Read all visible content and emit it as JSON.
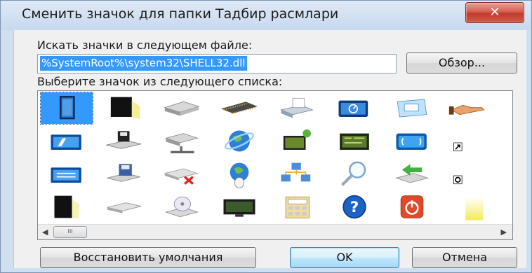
{
  "window": {
    "title": "Сменить значок для папки Тадбир расмлари",
    "close_glyph": "✕"
  },
  "dialog": {
    "file_label": "Искать значки в следующем файле:",
    "file_path": "%SystemRoot%\\system32\\SHELL32.dll",
    "browse_label": "Обзор...",
    "list_label": "Выберите значок из следующего списка:",
    "restore_label": "Восстановить умолчания",
    "ok_label": "OK",
    "cancel_label": "Отмена"
  },
  "icons": [
    [
      "blank-document-icon",
      "black-monitor-icon",
      "hard-drive-icon",
      "memory-chip-icon",
      "printer-icon",
      "display-settings-icon",
      "tablet-screen-icon",
      "hand-share-icon"
    ],
    [
      "card-reader-icon",
      "floppy-drive-icon",
      "network-drive-icon",
      "internet-globe-icon",
      "monitor-plant-icon",
      "circuit-board-icon",
      "screen-brackets-icon",
      "shortcut-arrow-overlay-icon"
    ],
    [
      "keyboard-panel-icon",
      "floppy-disk-icon",
      "disconnected-drive-icon",
      "globe-mouse-icon",
      "network-computers-icon",
      "magnifier-icon",
      "green-arrow-drive-icon",
      "disc-overlay-icon"
    ],
    [
      "dark-folder-icon",
      "flat-drive-icon",
      "cd-drive-icon",
      "lcd-monitor-icon",
      "calculator-panel-icon",
      "help-question-icon",
      "power-off-icon",
      "yellow-light-icon"
    ]
  ],
  "selected_icon": [
    0,
    0
  ],
  "scrollbar": {
    "left_arrow": "◀",
    "right_arrow": "▶",
    "thumb_grip": "III"
  }
}
